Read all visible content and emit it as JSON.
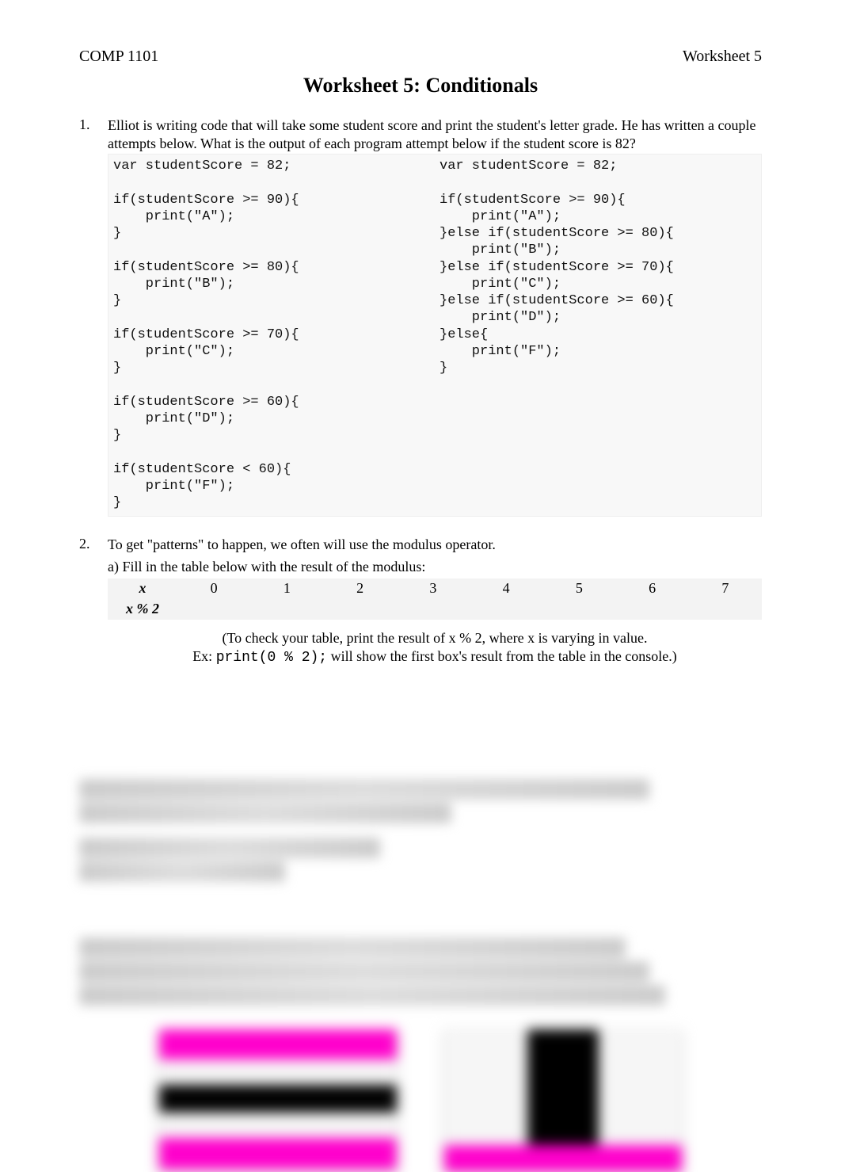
{
  "header": {
    "course": "COMP 1101",
    "worksheet": "Worksheet 5"
  },
  "title": "Worksheet 5: Conditionals",
  "q1": {
    "num": "1.",
    "text": "Elliot is writing code that will take some student score and print the student's letter grade. He has written a couple attempts below. What is the output of each program attempt below if the student score is 82?",
    "code_left": "var studentScore = 82;\n\nif(studentScore >= 90){\n    print(\"A\");\n}\n\nif(studentScore >= 80){\n    print(\"B\");\n}\n\nif(studentScore >= 70){\n    print(\"C\");\n}\n\nif(studentScore >= 60){\n    print(\"D\");\n}\n\nif(studentScore < 60){\n    print(\"F\");\n}",
    "code_right": "var studentScore = 82;\n\nif(studentScore >= 90){\n    print(\"A\");\n}else if(studentScore >= 80){\n    print(\"B\");\n}else if(studentScore >= 70){\n    print(\"C\");\n}else if(studentScore >= 60){\n    print(\"D\");\n}else{\n    print(\"F\");\n}"
  },
  "q2": {
    "num": "2.",
    "text": "To get \"patterns\" to happen, we often will use the modulus operator.",
    "part_a": "a) Fill in the table below with the result of the modulus:",
    "table": {
      "row_x_label": "x",
      "row_mod_label": "x % 2",
      "x_values": [
        "0",
        "1",
        "2",
        "3",
        "4",
        "5",
        "6",
        "7"
      ]
    },
    "hint_line1": "(To check your table, print the result of x % 2, where x is varying in value.",
    "hint_line2_pre": "Ex:  ",
    "hint_line2_code": "print(0 % 2);",
    "hint_line2_post": "  will show the first box's result from the table in the console.)"
  }
}
